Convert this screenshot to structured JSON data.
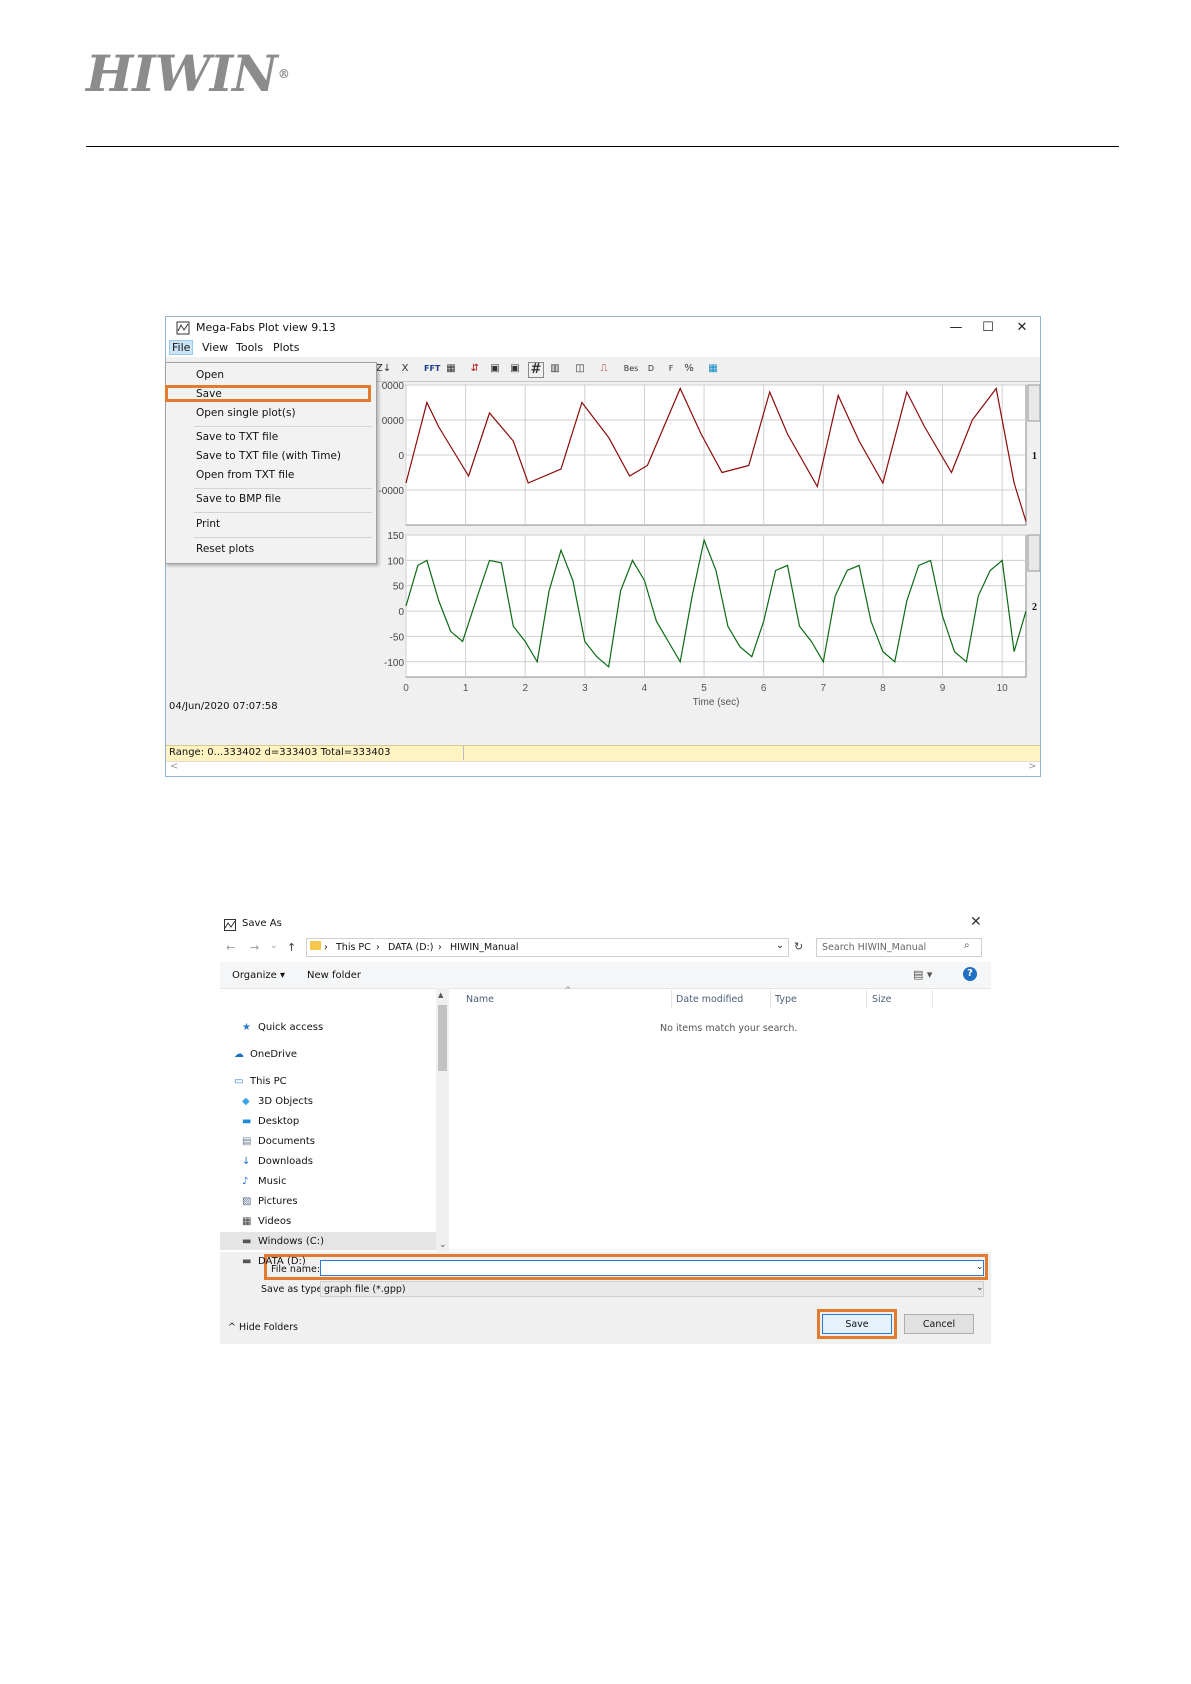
{
  "header": {
    "logo_text": "HIWIN",
    "logo_mark": "®"
  },
  "plot_window": {
    "title": "Mega-Fabs Plot view 9.13",
    "window_controls": {
      "minimize": "—",
      "maximize": "☐",
      "close": "✕"
    },
    "menus": [
      "File",
      "View",
      "Tools",
      "Plots"
    ],
    "toolbar": [
      "Z↓",
      "X",
      "FFT",
      "▦",
      "⇵",
      "▣",
      "▣",
      "#",
      "▥",
      "◫",
      "⎍",
      "Bes",
      "D",
      "F",
      "%",
      "▦"
    ],
    "file_menu": {
      "items": [
        "Open",
        "Save",
        "Open single plot(s)",
        "Save to TXT file",
        "Save to TXT file (with Time)",
        "Open from TXT file",
        "Save to BMP file",
        "Print",
        "Reset plots"
      ],
      "highlighted": "Save"
    },
    "timestamp": "04/Jun/2020  07:07:58",
    "status": "Range: 0...333402 d=333403 Total=333403",
    "scroll_left": "<",
    "scroll_right": ">"
  },
  "chart_data": {
    "type": "line",
    "xlabel": "Time (sec)",
    "xlim": [
      0,
      10.4
    ],
    "xticks": [
      "0",
      "1",
      "2",
      "3",
      "4",
      "5",
      "6",
      "7",
      "8",
      "9",
      "10"
    ],
    "panels": [
      {
        "id": "1",
        "color": "#8b0a0a",
        "ylim": [
          -20000,
          20000
        ],
        "ytick_labels": [
          "0000",
          "0000",
          "0",
          "-0000"
        ],
        "ytick_values": [
          20000,
          10000,
          0,
          -10000
        ],
        "x": [
          0,
          0.35,
          0.55,
          1.05,
          1.4,
          1.8,
          2.05,
          2.6,
          2.95,
          3.4,
          3.75,
          4.05,
          4.6,
          4.95,
          5.3,
          5.75,
          6.1,
          6.4,
          6.9,
          7.25,
          7.6,
          8.0,
          8.4,
          8.7,
          9.15,
          9.5,
          9.9,
          10.2,
          10.4
        ],
        "y": [
          -8000,
          15000,
          8000,
          -6000,
          12000,
          4000,
          -8000,
          -4000,
          15000,
          5000,
          -6000,
          -3000,
          19000,
          6000,
          -5000,
          -3000,
          18000,
          6000,
          -9000,
          17000,
          4000,
          -8000,
          18000,
          8000,
          -5000,
          10000,
          19000,
          -8000,
          -19000
        ]
      },
      {
        "id": "2",
        "color": "#0b6b14",
        "ylim": [
          -130,
          150
        ],
        "ytick_labels": [
          "150",
          "100",
          "50",
          "0",
          "-50",
          "-100"
        ],
        "ytick_values": [
          150,
          100,
          50,
          0,
          -50,
          -100
        ],
        "x": [
          0,
          0.2,
          0.35,
          0.55,
          0.75,
          0.95,
          1.2,
          1.4,
          1.6,
          1.8,
          2.0,
          2.2,
          2.4,
          2.6,
          2.8,
          3.0,
          3.2,
          3.4,
          3.6,
          3.8,
          4.0,
          4.2,
          4.4,
          4.6,
          4.8,
          5.0,
          5.2,
          5.4,
          5.6,
          5.8,
          6.0,
          6.2,
          6.4,
          6.6,
          6.8,
          7.0,
          7.2,
          7.4,
          7.6,
          7.8,
          8.0,
          8.2,
          8.4,
          8.6,
          8.8,
          9.0,
          9.2,
          9.4,
          9.6,
          9.8,
          10.0,
          10.2,
          10.4
        ],
        "y": [
          10,
          90,
          100,
          20,
          -40,
          -60,
          30,
          100,
          95,
          -30,
          -60,
          -100,
          40,
          120,
          60,
          -60,
          -90,
          -110,
          40,
          100,
          60,
          -20,
          -60,
          -100,
          30,
          140,
          80,
          -30,
          -70,
          -90,
          -20,
          80,
          90,
          -30,
          -60,
          -100,
          30,
          80,
          90,
          -20,
          -80,
          -100,
          20,
          90,
          100,
          -10,
          -80,
          -100,
          30,
          80,
          100,
          -80,
          0
        ]
      }
    ]
  },
  "save_as": {
    "title": "Save As",
    "close": "✕",
    "nav": {
      "back": "←",
      "forward": "→",
      "dropdown": "⌄",
      "up": "↑"
    },
    "breadcrumb": [
      "This PC",
      "DATA (D:)",
      "HIWIN_Manual"
    ],
    "breadcrumb_sep": "›",
    "address_dropdown": "⌄",
    "refresh": "↻",
    "search_placeholder": "Search HIWIN_Manual",
    "search_glyph": "⌕",
    "commands": {
      "organize": "Organize ▾",
      "new_folder": "New folder",
      "view": "▤ ▾",
      "help": "?"
    },
    "nav_items": [
      {
        "label": "Quick access",
        "icon": "★",
        "color": "#2b78d2"
      },
      {
        "label": "OneDrive",
        "icon": "☁",
        "color": "#1f6fc5"
      },
      {
        "label": "This PC",
        "icon": "▭",
        "color": "#2b78d2"
      },
      {
        "label": "3D Objects",
        "icon": "◆",
        "color": "#3ba3e6"
      },
      {
        "label": "Desktop",
        "icon": "▬",
        "color": "#1f8ad8"
      },
      {
        "label": "Documents",
        "icon": "▤",
        "color": "#6a7b93"
      },
      {
        "label": "Downloads",
        "icon": "↓",
        "color": "#1f6fc5"
      },
      {
        "label": "Music",
        "icon": "♪",
        "color": "#1f6fc5"
      },
      {
        "label": "Pictures",
        "icon": "▨",
        "color": "#5a6f8c"
      },
      {
        "label": "Videos",
        "icon": "▦",
        "color": "#444444"
      },
      {
        "label": "Windows (C:)",
        "icon": "▬",
        "color": "#555555"
      },
      {
        "label": "DATA (D:)",
        "icon": "▬",
        "color": "#555555"
      }
    ],
    "nav_scroll": {
      "up": "▲",
      "down": "⌄"
    },
    "columns": [
      "Name",
      "Date modified",
      "Type",
      "Size"
    ],
    "sort_indicator": "^",
    "empty_message": "No items match your search.",
    "file_name_label": "File name:",
    "file_name_value": "",
    "save_type_label": "Save as type:",
    "save_type_value": "graph  file (*.gpp)",
    "select_caret": "⌄",
    "hide_folders": "^  Hide Folders",
    "save_button": "Save",
    "cancel_button": "Cancel"
  },
  "colors": {
    "highlight": "#e07b2f",
    "accent": "#2a7ad6"
  }
}
